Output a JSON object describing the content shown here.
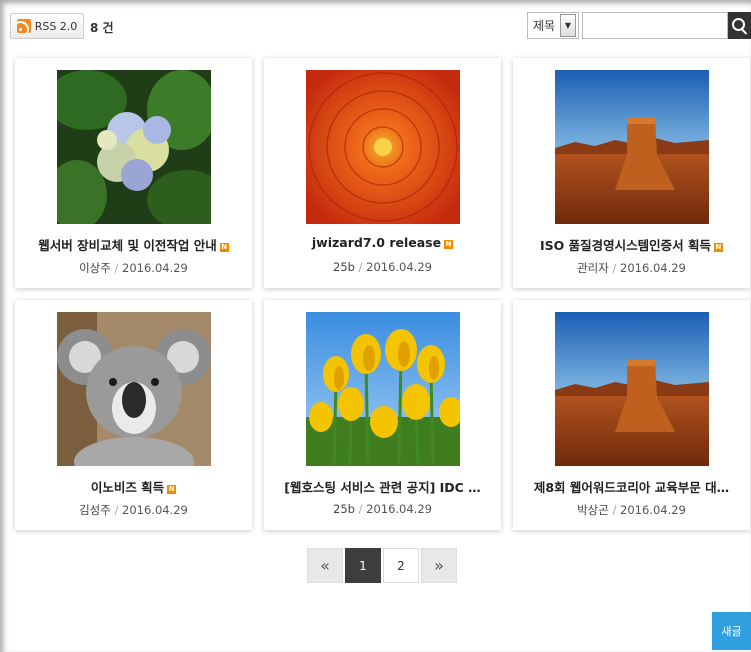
{
  "toolbar": {
    "rss_label": "RSS 2.0",
    "count_label": "8 건",
    "search_field_option": "제목",
    "search_placeholder": ""
  },
  "cards": [
    {
      "title": "웹서버 장비교체 및 이전작업 안내",
      "author": "이상주",
      "date": "2016.04.29",
      "image": "hydrangea"
    },
    {
      "title": "jwizard7.0 release",
      "author": "25b",
      "date": "2016.04.29",
      "image": "chrysanthemum"
    },
    {
      "title": "ISO 품질경영시스템인증서 획득",
      "author": "관리자",
      "date": "2016.04.29",
      "image": "desert"
    },
    {
      "title": "이노비즈 획득",
      "author": "김성주",
      "date": "2016.04.29",
      "image": "koala"
    },
    {
      "title": "[웹호스팅 서비스 관련 공지] IDC …",
      "author": "25b",
      "date": "2016.04.29",
      "image": "tulips"
    },
    {
      "title": "제8회 웹어워드코리아 교육부문 대…",
      "author": "박상곤",
      "date": "2016.04.29",
      "image": "desert"
    }
  ],
  "new_badge": "N",
  "meta_separator": " / ",
  "pagination": {
    "first_label": "«",
    "pages": [
      "1",
      "2"
    ],
    "current": "1",
    "last_label": "»"
  },
  "write_button_label": "새글",
  "colors": {
    "accent_blue": "#2f9fe0",
    "rss_orange": "#f28a1c",
    "new_badge": "#f08c00",
    "pager_active": "#3d3d3d"
  }
}
